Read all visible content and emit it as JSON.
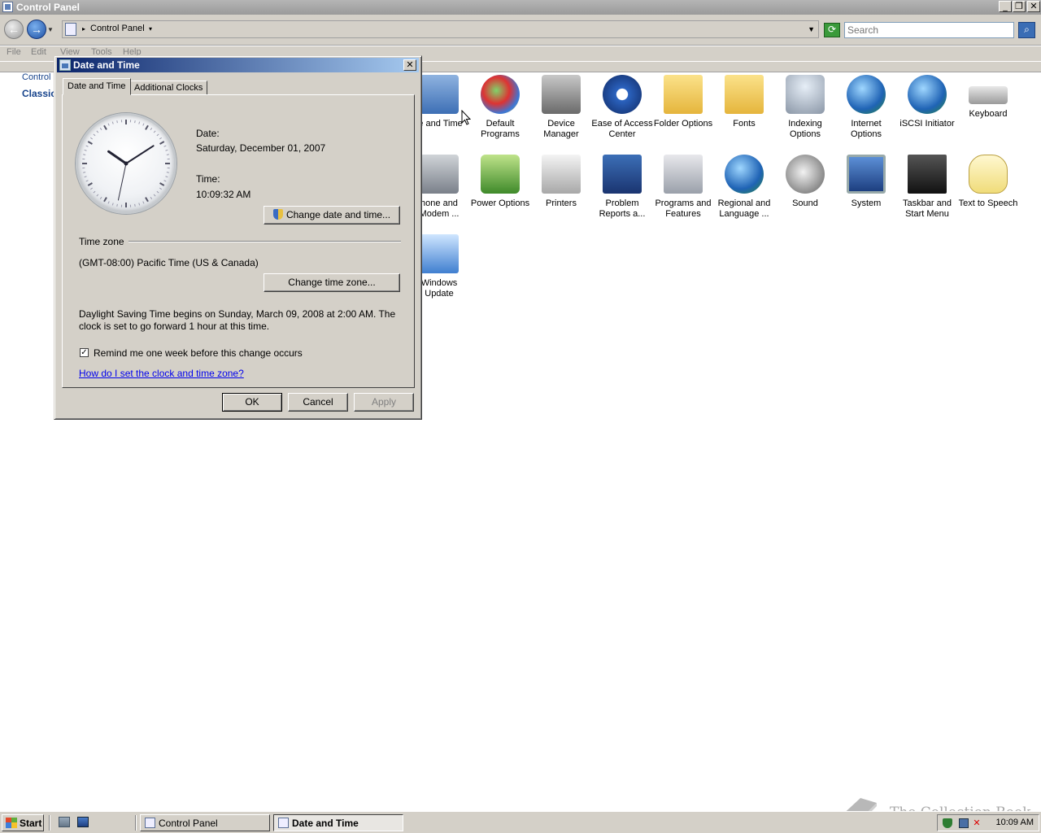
{
  "window": {
    "title": "Control Panel",
    "minimize": "_",
    "restore": "❐",
    "close": "✕"
  },
  "address_bar": {
    "location": "Control Panel",
    "search_placeholder": "Search"
  },
  "menu": {
    "items": [
      "File",
      "Edit",
      "View",
      "Tools",
      "Help"
    ]
  },
  "left_nav": {
    "home": "Control",
    "classic": "Classic"
  },
  "control_panel_items": [
    {
      "label": "te and Time",
      "icon": "date-time-icon"
    },
    {
      "label": "Default Programs",
      "icon": "default-programs-icon"
    },
    {
      "label": "Device Manager",
      "icon": "device-manager-icon"
    },
    {
      "label": "Ease of Access Center",
      "icon": "ease-of-access-icon"
    },
    {
      "label": "Folder Options",
      "icon": "folder-options-icon"
    },
    {
      "label": "Fonts",
      "icon": "fonts-icon"
    },
    {
      "label": "Indexing Options",
      "icon": "indexing-options-icon"
    },
    {
      "label": "Internet Options",
      "icon": "internet-options-icon"
    },
    {
      "label": "iSCSI Initiator",
      "icon": "iscsi-initiator-icon"
    },
    {
      "label": "Keyboard",
      "icon": "keyboard-icon"
    },
    {
      "label": "hone and Modem ...",
      "icon": "phone-modem-icon"
    },
    {
      "label": "Power Options",
      "icon": "power-options-icon"
    },
    {
      "label": "Printers",
      "icon": "printers-icon"
    },
    {
      "label": "Problem Reports a...",
      "icon": "problem-reports-icon"
    },
    {
      "label": "Programs and Features",
      "icon": "programs-features-icon"
    },
    {
      "label": "Regional and Language ...",
      "icon": "regional-language-icon"
    },
    {
      "label": "Sound",
      "icon": "sound-icon"
    },
    {
      "label": "System",
      "icon": "system-icon"
    },
    {
      "label": "Taskbar and Start Menu",
      "icon": "taskbar-start-menu-icon"
    },
    {
      "label": "Text to Speech",
      "icon": "text-to-speech-icon"
    },
    {
      "label": "Windows Update",
      "icon": "windows-update-icon"
    }
  ],
  "dialog": {
    "title": "Date and Time",
    "close": "✕",
    "tabs": [
      "Date and Time",
      "Additional Clocks"
    ],
    "date_label": "Date:",
    "date_value": "Saturday, December 01, 2007",
    "time_label": "Time:",
    "time_value": "10:09:32 AM",
    "clock": {
      "hour": 10,
      "minute": 9,
      "second": 32
    },
    "change_datetime_button": "Change date and time...",
    "timezone_heading": "Time zone",
    "timezone_value": "(GMT-08:00) Pacific Time (US & Canada)",
    "change_timezone_button": "Change time zone...",
    "dst_text": "Daylight Saving Time begins on Sunday, March 09, 2008 at 2:00 AM. The clock is set to go forward 1 hour at this time.",
    "remind_checked": true,
    "remind_label": "Remind me one week before this change occurs",
    "help_link": "How do I set the clock and time zone?",
    "ok": "OK",
    "cancel": "Cancel",
    "apply": "Apply"
  },
  "taskbar": {
    "start": "Start",
    "tasks": [
      "Control Panel",
      "Date and Time"
    ],
    "active_task": "Date and Time",
    "clock": "10:09 AM"
  },
  "watermark": {
    "text": "The Collection Book"
  },
  "colors": {
    "titlebar_active": "#0a246a",
    "face": "#d4d0c8",
    "link": "#0000ee"
  }
}
